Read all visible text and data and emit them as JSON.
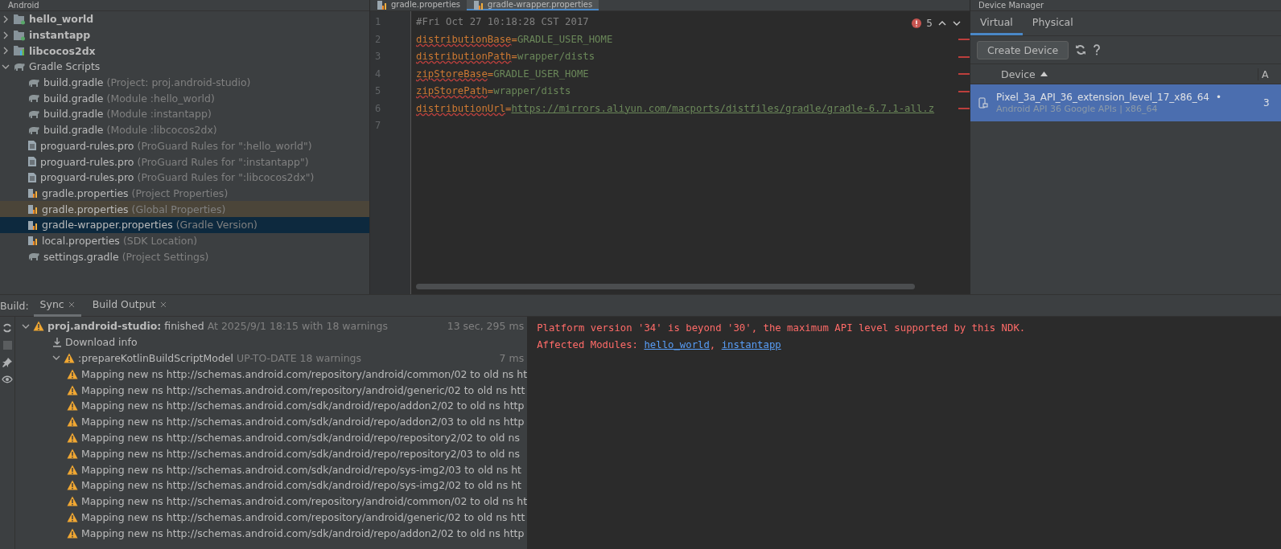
{
  "project_panel": {
    "title": "Android",
    "tree": [
      {
        "label": "hello_world",
        "kind": "module",
        "expanded": false
      },
      {
        "label": "instantapp",
        "kind": "module",
        "expanded": false
      },
      {
        "label": "libcocos2dx",
        "kind": "library",
        "expanded": false
      },
      {
        "label": "Gradle Scripts",
        "kind": "gradle-group",
        "expanded": true,
        "children": [
          {
            "label": "build.gradle",
            "hint": "(Project: proj.android-studio)",
            "kind": "gradle",
            "selected": false,
            "highlighted": false
          },
          {
            "label": "build.gradle",
            "hint": "(Module :hello_world)",
            "kind": "gradle",
            "selected": false,
            "highlighted": false
          },
          {
            "label": "build.gradle",
            "hint": "(Module :instantapp)",
            "kind": "gradle",
            "selected": false,
            "highlighted": false
          },
          {
            "label": "build.gradle",
            "hint": "(Module :libcocos2dx)",
            "kind": "gradle",
            "selected": false,
            "highlighted": false
          },
          {
            "label": "proguard-rules.pro",
            "hint": "(ProGuard Rules for \":hello_world\")",
            "kind": "text",
            "selected": false,
            "highlighted": false
          },
          {
            "label": "proguard-rules.pro",
            "hint": "(ProGuard Rules for \":instantapp\")",
            "kind": "text",
            "selected": false,
            "highlighted": false
          },
          {
            "label": "proguard-rules.pro",
            "hint": "(ProGuard Rules for \":libcocos2dx\")",
            "kind": "text",
            "selected": false,
            "highlighted": false
          },
          {
            "label": "gradle.properties",
            "hint": "(Project Properties)",
            "kind": "properties",
            "selected": false,
            "highlighted": false
          },
          {
            "label": "gradle.properties",
            "hint": "(Global Properties)",
            "kind": "properties",
            "selected": false,
            "highlighted": true
          },
          {
            "label": "gradle-wrapper.properties",
            "hint": "(Gradle Version)",
            "kind": "properties",
            "selected": true,
            "highlighted": false
          },
          {
            "label": "local.properties",
            "hint": "(SDK Location)",
            "kind": "properties",
            "selected": false,
            "highlighted": false
          },
          {
            "label": "settings.gradle",
            "hint": "(Project Settings)",
            "kind": "gradle",
            "selected": false,
            "highlighted": false
          }
        ]
      }
    ]
  },
  "editor": {
    "tabs": [
      {
        "label": "gradle.properties",
        "selected": false
      },
      {
        "label": "gradle-wrapper.properties",
        "selected": true
      }
    ],
    "problems": "5",
    "lines": [
      {
        "number": "1",
        "kind": "comment",
        "text": "#Fri Oct 27 10:18:28 CST 2017",
        "error": false
      },
      {
        "number": "2",
        "kind": "property",
        "key": "distributionBase",
        "separator": "=",
        "value": "GRADLE_USER_HOME",
        "error": true
      },
      {
        "number": "3",
        "kind": "property",
        "key": "distributionPath",
        "separator": "=",
        "value": "wrapper/dists",
        "error": true
      },
      {
        "number": "4",
        "kind": "property",
        "key": "zipStoreBase",
        "separator": "=",
        "value": "GRADLE_USER_HOME",
        "error": true
      },
      {
        "number": "5",
        "kind": "property",
        "key": "zipStorePath",
        "separator": "=",
        "value": "wrapper/dists",
        "error": true
      },
      {
        "number": "6",
        "kind": "url",
        "key": "distributionUrl",
        "separator": "=",
        "value": "https://mirrors.aliyun.com/macports/distfiles/gradle/gradle-6.7.1-all.z",
        "error": true
      },
      {
        "number": "7",
        "kind": "empty"
      }
    ]
  },
  "device_manager": {
    "title": "Device Manager",
    "tabs": [
      {
        "label": "Virtual",
        "selected": true
      },
      {
        "label": "Physical",
        "selected": false
      }
    ],
    "create_button": "Create Device",
    "columns": [
      "Device",
      "A"
    ],
    "devices": [
      {
        "name": "Pixel_3a_API_36_extension_level_17_x86_64",
        "status": "•",
        "details": "Android API 36 Google APIs | x86_64",
        "column_2": "3",
        "selected": true
      }
    ]
  },
  "build": {
    "label": "Build:",
    "tabs": [
      {
        "label": "Sync",
        "selected": true
      },
      {
        "label": "Build Output",
        "selected": false
      }
    ],
    "tree": [
      {
        "kind": "warning",
        "title": "proj.android-studio:",
        "text": "finished",
        "hint": "At 2025/9/1 18:15 with 18 warnings",
        "time": "13 sec, 295 ms",
        "expanded": true,
        "children": [
          {
            "kind": "download",
            "text": "Download info"
          },
          {
            "kind": "warning",
            "text": ":prepareKotlinBuildScriptModel",
            "hint": "UP-TO-DATE 18 warnings",
            "time": "7 ms",
            "expanded": true,
            "children": [
              {
                "kind": "warning",
                "text": "Mapping new ns http://schemas.android.com/repository/android/common/02 to old ns ht"
              },
              {
                "kind": "warning",
                "text": "Mapping new ns http://schemas.android.com/repository/android/generic/02 to old ns htt"
              },
              {
                "kind": "warning",
                "text": "Mapping new ns http://schemas.android.com/sdk/android/repo/addon2/02 to old ns http"
              },
              {
                "kind": "warning",
                "text": "Mapping new ns http://schemas.android.com/sdk/android/repo/addon2/03 to old ns http"
              },
              {
                "kind": "warning",
                "text": "Mapping new ns http://schemas.android.com/sdk/android/repo/repository2/02 to old ns"
              },
              {
                "kind": "warning",
                "text": "Mapping new ns http://schemas.android.com/sdk/android/repo/repository2/03 to old ns"
              },
              {
                "kind": "warning",
                "text": "Mapping new ns http://schemas.android.com/sdk/android/repo/sys-img2/03 to old ns ht"
              },
              {
                "kind": "warning",
                "text": "Mapping new ns http://schemas.android.com/sdk/android/repo/sys-img2/02 to old ns ht"
              },
              {
                "kind": "warning",
                "text": "Mapping new ns http://schemas.android.com/repository/android/common/02 to old ns ht"
              },
              {
                "kind": "warning",
                "text": "Mapping new ns http://schemas.android.com/repository/android/generic/02 to old ns htt"
              },
              {
                "kind": "warning",
                "text": "Mapping new ns http://schemas.android.com/sdk/android/repo/addon2/02 to old ns http"
              }
            ]
          }
        ]
      }
    ],
    "console": [
      {
        "kind": "text",
        "text": "Platform version '34' is beyond '30', the maximum API level supported by this NDK."
      },
      {
        "kind": "links",
        "text": "Affected Modules:",
        "links": [
          "hello_world",
          "instantapp"
        ],
        "separator": ","
      }
    ]
  }
}
